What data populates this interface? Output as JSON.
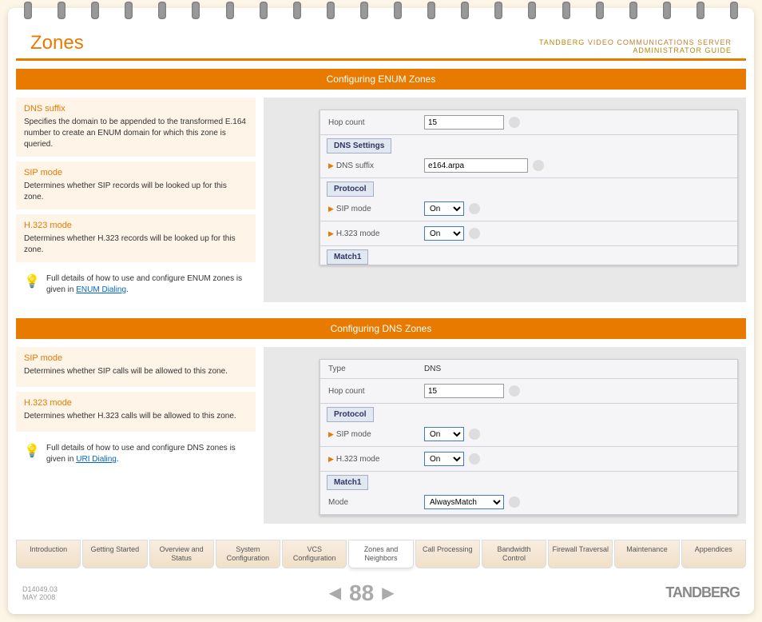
{
  "header": {
    "title": "Zones",
    "brand": "TANDBERG",
    "product": "VIDEO COMMUNICATIONS SERVER",
    "guide": "ADMINISTRATOR GUIDE"
  },
  "section1": {
    "title": "Configuring ENUM Zones",
    "items": [
      {
        "title": "DNS suffix",
        "text": "Specifies the domain to be appended to the transformed E.164 number to create an ENUM domain for which this zone is queried."
      },
      {
        "title": "SIP mode",
        "text": "Determines whether SIP records will be looked up for this zone."
      },
      {
        "title": "H.323 mode",
        "text": "Determines whether H.323 records will be looked up for this zone."
      }
    ],
    "info": {
      "text": "Full details of how to use and configure ENUM zones is given in ",
      "link": "ENUM Dialing",
      "suffix": "."
    },
    "screenshot": {
      "rows": [
        {
          "label": "Hop count",
          "type": "input",
          "value": "15"
        },
        {
          "tab": "DNS Settings"
        },
        {
          "label": "DNS suffix",
          "type": "input",
          "value": "e164.arpa",
          "arrow": true,
          "wide": true
        },
        {
          "tab": "Protocol"
        },
        {
          "label": "SIP mode",
          "type": "select",
          "value": "On",
          "arrow": true
        },
        {
          "label": "H.323 mode",
          "type": "select",
          "value": "On",
          "arrow": true
        },
        {
          "tab": "Match1"
        }
      ]
    }
  },
  "section2": {
    "title": "Configuring DNS Zones",
    "items": [
      {
        "title": "SIP mode",
        "text": "Determines whether SIP calls will be allowed to this zone."
      },
      {
        "title": "H.323 mode",
        "text": "Determines whether H.323 calls will be allowed to this zone."
      }
    ],
    "info": {
      "text": "Full details of how to use and configure DNS zones is given in ",
      "link": "URI Dialing",
      "suffix": "."
    },
    "screenshot": {
      "rows": [
        {
          "label": "Type",
          "type": "text",
          "value": "DNS"
        },
        {
          "label": "Hop count",
          "type": "input",
          "value": "15"
        },
        {
          "tab": "Protocol"
        },
        {
          "label": "SIP mode",
          "type": "select",
          "value": "On",
          "arrow": true
        },
        {
          "label": "H.323 mode",
          "type": "select",
          "value": "On",
          "arrow": true
        },
        {
          "tab": "Match1"
        },
        {
          "label": "Mode",
          "type": "select2",
          "value": "AlwaysMatch"
        }
      ]
    }
  },
  "nav": [
    "Introduction",
    "Getting Started",
    "Overview and Status",
    "System Configuration",
    "VCS Configuration",
    "Zones and Neighbors",
    "Call Processing",
    "Bandwidth Control",
    "Firewall Traversal",
    "Maintenance",
    "Appendices"
  ],
  "nav_active": 5,
  "footer": {
    "doc": "D14049.03",
    "date": "MAY 2008",
    "page": "88",
    "logo": "TANDBERG"
  }
}
